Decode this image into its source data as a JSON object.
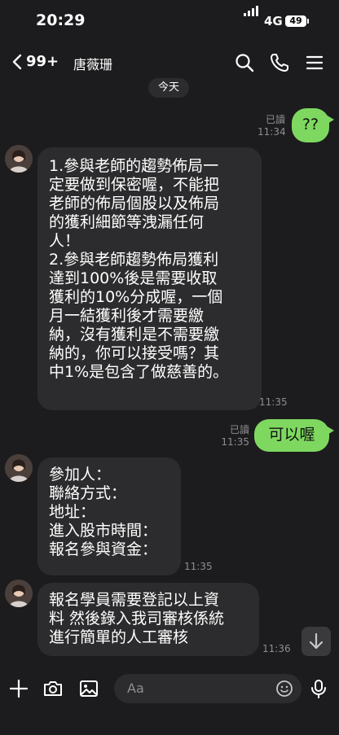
{
  "status_bar": {
    "time": "20:29",
    "network": "4G",
    "battery": "49"
  },
  "header": {
    "unread_count": "99+",
    "contact_name": "唐薇珊"
  },
  "date_divider": "今天",
  "messages": [
    {
      "side": "out",
      "text": "??",
      "read": "已讀",
      "time": "11:34"
    },
    {
      "side": "in",
      "text": "1.參與老師的趨勢佈局一\n定要做到保密喔，不能把\n老師的佈局個股以及佈局\n的獲利細節等洩漏任何\n人！\n2.參與老師趨勢佈局獲利\n達到100%後是需要收取\n獲利的10%分成喔，一個\n月一結獲利後才需要繳\n納，沒有獲利是不需要繳\n納的，你可以接受嗎？其\n中1%是包含了做慈善的。",
      "time": "11:35"
    },
    {
      "side": "out",
      "text": "可以喔",
      "read": "已讀",
      "time": "11:35"
    },
    {
      "side": "in",
      "text": "參加人：\n聯絡方式：\n地址：\n進入股市時間：\n報名參與資金：",
      "time": "11:35"
    },
    {
      "side": "in",
      "text": "報名學員需要登記以上資\n料 然後錄入我司審核係統\n進行簡單的人工審核",
      "time": "11:36"
    }
  ],
  "input": {
    "placeholder": "Aa"
  },
  "colors": {
    "outgoing_bubble": "#7ed860",
    "incoming_bubble": "#2c2c2e",
    "background": "#1c1c1e"
  }
}
